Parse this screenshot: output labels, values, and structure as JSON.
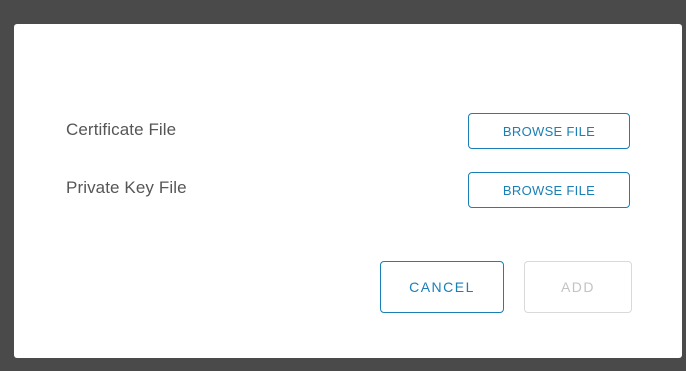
{
  "dialog": {
    "rows": [
      {
        "label": "Certificate File",
        "button_label": "BROWSE FILE"
      },
      {
        "label": "Private Key File",
        "button_label": "BROWSE FILE"
      }
    ],
    "actions": {
      "cancel_label": "CANCEL",
      "add_label": "ADD",
      "add_disabled": true
    }
  },
  "colors": {
    "backdrop": "#4a4a4a",
    "dialog_bg": "#ffffff",
    "accent": "#1a7fb5",
    "label_text": "#565656",
    "disabled_border": "#d9d9d9",
    "disabled_text": "#c3c3c3"
  }
}
